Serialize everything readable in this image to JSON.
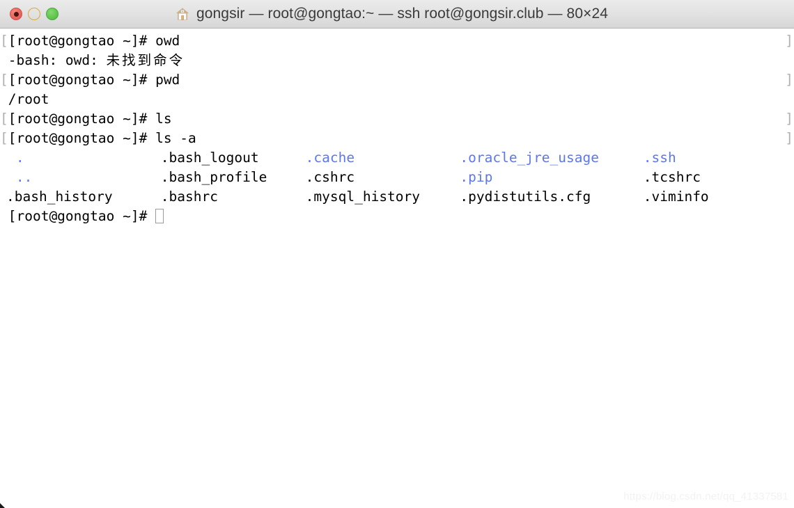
{
  "window": {
    "title": "gongsir — root@gongtao:~ — ssh root@gongsir.club — 80×24",
    "icon": "home-icon",
    "traffic_lights": {
      "close_label": "Close",
      "minimize_label": "Minimize",
      "maximize_label": "Maximize",
      "close_color": "#e8645c",
      "minimize_color": "#f2bf4d",
      "maximize_color": "#5cc44a"
    }
  },
  "colors": {
    "background": "#ffffff",
    "foreground": "#000000",
    "directory": "#5c77f0",
    "wrap_marker": "#b0b0b0",
    "cursor_border": "#9a9a9a",
    "titlebar_top": "#ebebeb",
    "titlebar_bottom": "#d6d6d6"
  },
  "terminal": {
    "size": "80×24",
    "prompt": "[root@gongtao ~]# ",
    "wrap_marker_left": "[",
    "wrap_marker_right": "]",
    "lines": [
      {
        "id": "line-1-prompt-owd",
        "wrap_left": true,
        "wrap_right": true,
        "prompt": "[root@gongtao ~]# ",
        "command": "owd"
      },
      {
        "id": "line-2-error",
        "wrap_left": false,
        "wrap_right": false,
        "text_ascii": " -bash: owd: ",
        "text_cjk": "未找到命令"
      },
      {
        "id": "line-3-prompt-pwd",
        "wrap_left": true,
        "wrap_right": true,
        "prompt": "[root@gongtao ~]# ",
        "command": "pwd"
      },
      {
        "id": "line-4-pwd-output",
        "wrap_left": false,
        "wrap_right": false,
        "text": " /root"
      },
      {
        "id": "line-5-prompt-ls",
        "wrap_left": true,
        "wrap_right": true,
        "prompt": "[root@gongtao ~]# ",
        "command": "ls"
      },
      {
        "id": "line-6-prompt-ls-a",
        "wrap_left": true,
        "wrap_right": true,
        "prompt": "[root@gongtao ~]# ",
        "command": "ls -a"
      }
    ],
    "listing_rows": [
      [
        {
          "name": ".",
          "type": "dir",
          "col": 1
        },
        {
          "name": ".bash_logout",
          "type": "file",
          "col": 16
        },
        {
          "name": ".cache",
          "type": "dir",
          "col": 31
        },
        {
          "name": ".oracle_jre_usage",
          "type": "dir",
          "col": 47
        },
        {
          "name": ".ssh",
          "type": "dir",
          "col": 66
        }
      ],
      [
        {
          "name": "..",
          "type": "dir",
          "col": 1
        },
        {
          "name": ".bash_profile",
          "type": "file",
          "col": 16
        },
        {
          "name": ".cshrc",
          "type": "file",
          "col": 31
        },
        {
          "name": ".pip",
          "type": "dir",
          "col": 47
        },
        {
          "name": ".tcshrc",
          "type": "file",
          "col": 66
        }
      ],
      [
        {
          "name": ".bash_history",
          "type": "file",
          "col": 0
        },
        {
          "name": ".bashrc",
          "type": "file",
          "col": 16
        },
        {
          "name": ".mysql_history",
          "type": "file",
          "col": 31
        },
        {
          "name": ".pydistutils.cfg",
          "type": "file",
          "col": 47
        },
        {
          "name": ".viminfo",
          "type": "file",
          "col": 66
        }
      ]
    ],
    "final_line": {
      "id": "line-final-prompt",
      "prompt": " [root@gongtao ~]# ",
      "cursor": "block-outline"
    }
  },
  "watermark": {
    "text": "https://blog.csdn.net/qq_41337581"
  }
}
